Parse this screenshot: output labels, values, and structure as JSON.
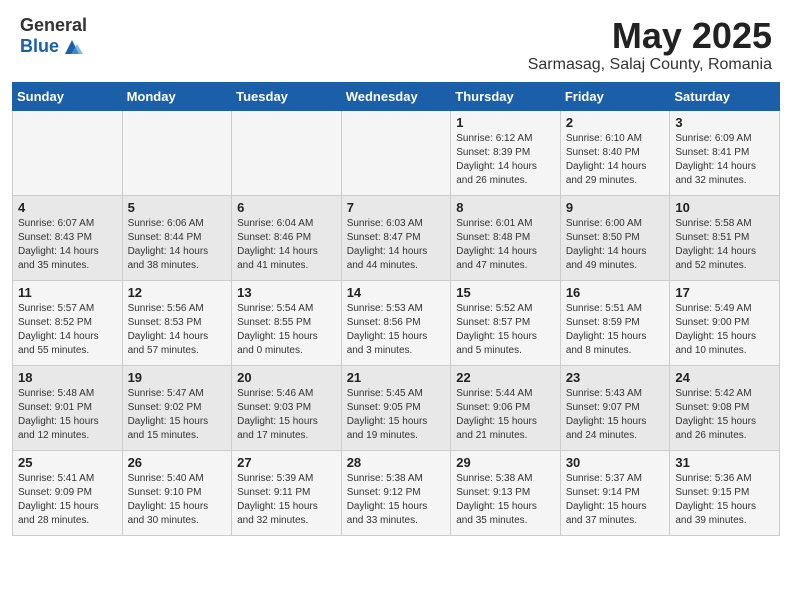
{
  "header": {
    "logo_general": "General",
    "logo_blue": "Blue",
    "month_year": "May 2025",
    "location": "Sarmasag, Salaj County, Romania"
  },
  "days_of_week": [
    "Sunday",
    "Monday",
    "Tuesday",
    "Wednesday",
    "Thursday",
    "Friday",
    "Saturday"
  ],
  "weeks": [
    [
      {
        "day": "",
        "content": ""
      },
      {
        "day": "",
        "content": ""
      },
      {
        "day": "",
        "content": ""
      },
      {
        "day": "",
        "content": ""
      },
      {
        "day": "1",
        "content": "Sunrise: 6:12 AM\nSunset: 8:39 PM\nDaylight: 14 hours and 26 minutes."
      },
      {
        "day": "2",
        "content": "Sunrise: 6:10 AM\nSunset: 8:40 PM\nDaylight: 14 hours and 29 minutes."
      },
      {
        "day": "3",
        "content": "Sunrise: 6:09 AM\nSunset: 8:41 PM\nDaylight: 14 hours and 32 minutes."
      }
    ],
    [
      {
        "day": "4",
        "content": "Sunrise: 6:07 AM\nSunset: 8:43 PM\nDaylight: 14 hours and 35 minutes."
      },
      {
        "day": "5",
        "content": "Sunrise: 6:06 AM\nSunset: 8:44 PM\nDaylight: 14 hours and 38 minutes."
      },
      {
        "day": "6",
        "content": "Sunrise: 6:04 AM\nSunset: 8:46 PM\nDaylight: 14 hours and 41 minutes."
      },
      {
        "day": "7",
        "content": "Sunrise: 6:03 AM\nSunset: 8:47 PM\nDaylight: 14 hours and 44 minutes."
      },
      {
        "day": "8",
        "content": "Sunrise: 6:01 AM\nSunset: 8:48 PM\nDaylight: 14 hours and 47 minutes."
      },
      {
        "day": "9",
        "content": "Sunrise: 6:00 AM\nSunset: 8:50 PM\nDaylight: 14 hours and 49 minutes."
      },
      {
        "day": "10",
        "content": "Sunrise: 5:58 AM\nSunset: 8:51 PM\nDaylight: 14 hours and 52 minutes."
      }
    ],
    [
      {
        "day": "11",
        "content": "Sunrise: 5:57 AM\nSunset: 8:52 PM\nDaylight: 14 hours and 55 minutes."
      },
      {
        "day": "12",
        "content": "Sunrise: 5:56 AM\nSunset: 8:53 PM\nDaylight: 14 hours and 57 minutes."
      },
      {
        "day": "13",
        "content": "Sunrise: 5:54 AM\nSunset: 8:55 PM\nDaylight: 15 hours and 0 minutes."
      },
      {
        "day": "14",
        "content": "Sunrise: 5:53 AM\nSunset: 8:56 PM\nDaylight: 15 hours and 3 minutes."
      },
      {
        "day": "15",
        "content": "Sunrise: 5:52 AM\nSunset: 8:57 PM\nDaylight: 15 hours and 5 minutes."
      },
      {
        "day": "16",
        "content": "Sunrise: 5:51 AM\nSunset: 8:59 PM\nDaylight: 15 hours and 8 minutes."
      },
      {
        "day": "17",
        "content": "Sunrise: 5:49 AM\nSunset: 9:00 PM\nDaylight: 15 hours and 10 minutes."
      }
    ],
    [
      {
        "day": "18",
        "content": "Sunrise: 5:48 AM\nSunset: 9:01 PM\nDaylight: 15 hours and 12 minutes."
      },
      {
        "day": "19",
        "content": "Sunrise: 5:47 AM\nSunset: 9:02 PM\nDaylight: 15 hours and 15 minutes."
      },
      {
        "day": "20",
        "content": "Sunrise: 5:46 AM\nSunset: 9:03 PM\nDaylight: 15 hours and 17 minutes."
      },
      {
        "day": "21",
        "content": "Sunrise: 5:45 AM\nSunset: 9:05 PM\nDaylight: 15 hours and 19 minutes."
      },
      {
        "day": "22",
        "content": "Sunrise: 5:44 AM\nSunset: 9:06 PM\nDaylight: 15 hours and 21 minutes."
      },
      {
        "day": "23",
        "content": "Sunrise: 5:43 AM\nSunset: 9:07 PM\nDaylight: 15 hours and 24 minutes."
      },
      {
        "day": "24",
        "content": "Sunrise: 5:42 AM\nSunset: 9:08 PM\nDaylight: 15 hours and 26 minutes."
      }
    ],
    [
      {
        "day": "25",
        "content": "Sunrise: 5:41 AM\nSunset: 9:09 PM\nDaylight: 15 hours and 28 minutes."
      },
      {
        "day": "26",
        "content": "Sunrise: 5:40 AM\nSunset: 9:10 PM\nDaylight: 15 hours and 30 minutes."
      },
      {
        "day": "27",
        "content": "Sunrise: 5:39 AM\nSunset: 9:11 PM\nDaylight: 15 hours and 32 minutes."
      },
      {
        "day": "28",
        "content": "Sunrise: 5:38 AM\nSunset: 9:12 PM\nDaylight: 15 hours and 33 minutes."
      },
      {
        "day": "29",
        "content": "Sunrise: 5:38 AM\nSunset: 9:13 PM\nDaylight: 15 hours and 35 minutes."
      },
      {
        "day": "30",
        "content": "Sunrise: 5:37 AM\nSunset: 9:14 PM\nDaylight: 15 hours and 37 minutes."
      },
      {
        "day": "31",
        "content": "Sunrise: 5:36 AM\nSunset: 9:15 PM\nDaylight: 15 hours and 39 minutes."
      }
    ]
  ]
}
